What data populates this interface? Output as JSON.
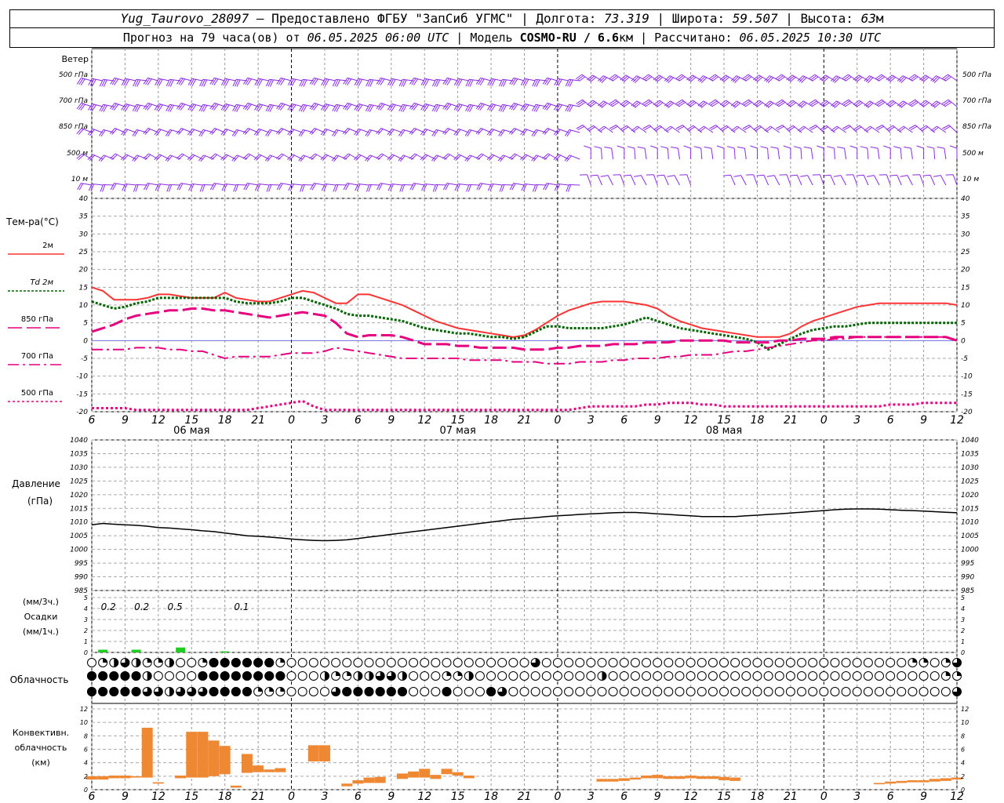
{
  "header": {
    "station": "Yug_Taurovo_28097",
    "provider": " – Предоставлено ФГБУ \"ЗапСиб УГМС\" | Долгота: ",
    "lon": "73.319",
    "lat_label": " | Широта: ",
    "lat": "59.507",
    "alt_label": " | Высота: ",
    "alt": "63",
    "alt_unit": "м",
    "fc_label": "Прогноз на 79 часа(ов) от ",
    "fc_time": "06.05.2025 06:00 UTC",
    "model_label": " | Модель ",
    "model": "COSMO-RU / 6.6",
    "model_unit": "км",
    "calc_label": " | Рассчитано: ",
    "calc_time": "06.05.2025 10:30 UTC"
  },
  "wind_panel": {
    "title": "Ветер",
    "levels": [
      "500 гПа",
      "700 гПа",
      "850 гПа",
      "500 м",
      "10 м"
    ]
  },
  "temp_panel": {
    "title": "Тем-ра(°С)",
    "legend": [
      {
        "label": "2м",
        "color": "#ff3333",
        "style": "solid"
      },
      {
        "label": "Td  2м",
        "color": "#006400",
        "style": "dotted"
      },
      {
        "label": "850 гПа",
        "color": "#e6007e",
        "style": "dash"
      },
      {
        "label": "700 гПа",
        "color": "#e6007e",
        "style": "dashdot"
      },
      {
        "label": "500 гПа",
        "color": "#e6007e",
        "style": "dot"
      }
    ],
    "ticks": [
      "40",
      "35",
      "30",
      "25",
      "20",
      "15",
      "10",
      "5",
      "0",
      "-5",
      "-10",
      "-15",
      "-20"
    ],
    "xticks": [
      "6",
      "9",
      "12",
      "15",
      "18",
      "21",
      "0",
      "3",
      "6",
      "9",
      "12",
      "15",
      "18",
      "21",
      "0",
      "3",
      "6",
      "9",
      "12",
      "15",
      "18",
      "21",
      "0",
      "3",
      "6",
      "9",
      "12"
    ],
    "dates": [
      "06 мая",
      "07 мая",
      "08 мая"
    ]
  },
  "pressure_panel": {
    "title": "Давление",
    "unit": "(гПа)",
    "ticks": [
      "1040",
      "1035",
      "1030",
      "1025",
      "1020",
      "1015",
      "1010",
      "1005",
      "1000",
      "995",
      "990",
      "985"
    ]
  },
  "precip_panel": {
    "label1": "(мм/3ч.)",
    "label2": "Осадки",
    "label3": "(мм/1ч.)",
    "ticks": [
      "5",
      "4",
      "3",
      "2",
      "1",
      "0"
    ],
    "totals": [
      "0.2",
      "0.2",
      "0.5",
      "0.1"
    ]
  },
  "cloud_panel": {
    "title": "Облачность"
  },
  "conv_panel": {
    "label1": "Конвективн.",
    "label2": "облачность",
    "label3": "(км)",
    "ticks": [
      "12",
      "10",
      "8",
      "6",
      "4",
      "2",
      "0"
    ]
  },
  "colors": {
    "wind": "#8a2be2",
    "t2m": "#ff3333",
    "td2m": "#006400",
    "upper": "#e6007e",
    "pressure": "#000000",
    "precip": "#22cc22",
    "conv": "#ee8833"
  },
  "chart_data": [
    {
      "type": "line",
      "name": "temperature",
      "x_hours": [
        0,
        1,
        2,
        3,
        4,
        5,
        6,
        7,
        8,
        9,
        10,
        11,
        12,
        13,
        14,
        15,
        16,
        17,
        18,
        19,
        20,
        21,
        22,
        23,
        24,
        25,
        26,
        27,
        28,
        29,
        30,
        31,
        32,
        33,
        34,
        35,
        36,
        37,
        38,
        39,
        40,
        41,
        42,
        43,
        44,
        45,
        46,
        47,
        48,
        49,
        50,
        51,
        52,
        53,
        54,
        55,
        56,
        57,
        58,
        59,
        60,
        61,
        62,
        63,
        64,
        65,
        66,
        67,
        68,
        69,
        70,
        71,
        72,
        73,
        74,
        75,
        76,
        77,
        78
      ],
      "ylim": [
        -20,
        40
      ],
      "series": [
        {
          "name": "2м",
          "values": [
            15,
            14,
            11.5,
            11.5,
            11.5,
            12,
            13,
            13,
            12.5,
            12,
            12,
            12,
            13.5,
            12,
            11.5,
            11,
            11,
            12,
            13,
            14,
            13.5,
            12,
            10.5,
            10.5,
            13,
            13,
            12,
            11,
            10,
            8.5,
            7,
            5.5,
            4.5,
            3.5,
            3,
            2.5,
            2,
            1.5,
            1,
            1.5,
            3,
            5,
            7,
            8.5,
            9.5,
            10.5,
            11,
            11,
            11,
            10.5,
            10,
            9,
            7,
            5.5,
            4.5,
            3.5,
            3,
            2.5,
            2,
            1.5,
            1,
            1,
            1,
            2,
            4,
            5.5,
            6.5,
            7.5,
            8.5,
            9.5,
            10,
            10.5,
            10.5,
            10.5,
            10.5,
            10.5,
            10.5,
            10.5,
            10
          ]
        },
        {
          "name": "Td  2м",
          "values": [
            11,
            10,
            9,
            9.5,
            10.5,
            11,
            12,
            12,
            12,
            12,
            12,
            12,
            12,
            11,
            10.5,
            10.5,
            10.5,
            11,
            12,
            12,
            11,
            10,
            9,
            7.5,
            7,
            7,
            6.5,
            6,
            5.5,
            4.5,
            3.5,
            3,
            2.5,
            2,
            2,
            1.5,
            1,
            1,
            0.5,
            1,
            2.5,
            4,
            4,
            3.5,
            3.5,
            3.5,
            3.5,
            4,
            4.5,
            5.5,
            6.5,
            5.5,
            4.5,
            3.5,
            3,
            2.5,
            2,
            1.5,
            1,
            0.5,
            -0.5,
            -2.5,
            -1,
            0.5,
            2,
            3,
            3.5,
            4,
            4,
            4.5,
            5,
            5,
            5,
            5,
            5,
            5,
            5,
            5,
            5
          ]
        },
        {
          "name": "850 гПа",
          "values": [
            2.5,
            3.5,
            4.5,
            6,
            7,
            7.5,
            8,
            8.5,
            8.5,
            9,
            9,
            8.5,
            8.5,
            8,
            7.5,
            7,
            6.5,
            7,
            7.5,
            8,
            7.5,
            7,
            5,
            2,
            1,
            1.5,
            1.5,
            1.5,
            1,
            0,
            -1,
            -1,
            -1,
            -1.5,
            -1.5,
            -2,
            -2,
            -2,
            -2,
            -2.5,
            -2.5,
            -2.5,
            -2,
            -2,
            -1.5,
            -1.5,
            -1.5,
            -1,
            -1,
            -1,
            -0.5,
            -0.5,
            -0.5,
            0,
            0,
            0,
            0,
            0,
            -0.5,
            -0.5,
            -0.5,
            -0.5,
            0,
            0,
            0.5,
            0.5,
            0.5,
            1,
            1,
            1,
            1,
            1,
            1,
            1,
            1,
            1,
            1,
            1,
            0
          ]
        },
        {
          "name": "700 гПа",
          "values": [
            -2.5,
            -2.5,
            -2.5,
            -2.5,
            -2,
            -2,
            -2,
            -2.5,
            -2.5,
            -3,
            -3,
            -4,
            -5,
            -4.5,
            -4.5,
            -4.5,
            -4.5,
            -4,
            -3.5,
            -3.5,
            -3.5,
            -3,
            -2,
            -2.5,
            -3,
            -3.5,
            -4,
            -4.5,
            -5,
            -5,
            -5,
            -5,
            -5,
            -5,
            -5.5,
            -5.5,
            -5.5,
            -5.5,
            -6,
            -6,
            -6,
            -6.5,
            -6.5,
            -6.5,
            -6,
            -6,
            -6,
            -5.5,
            -5.5,
            -5,
            -5,
            -5,
            -4.5,
            -4.5,
            -4,
            -4,
            -4,
            -3.5,
            -3,
            -3,
            -2.5,
            -2,
            -1.5,
            -1,
            -0.5,
            0,
            0,
            0.5,
            0.5,
            1,
            1,
            1,
            1,
            1,
            1,
            1,
            1,
            1,
            0
          ]
        },
        {
          "name": "500 гПа",
          "values": [
            -19,
            -19,
            -19,
            -19,
            -19.5,
            -19.5,
            -19.5,
            -19.5,
            -19.5,
            -19.5,
            -19.5,
            -19.5,
            -19.5,
            -19.5,
            -19.5,
            -19,
            -18.5,
            -18,
            -17.5,
            -17,
            -18.5,
            -19.5,
            -19.5,
            -19.5,
            -19.5,
            -19.5,
            -19.5,
            -19.5,
            -19.5,
            -19.5,
            -19.5,
            -19.5,
            -19.5,
            -19.5,
            -19.5,
            -19.5,
            -19.5,
            -19.5,
            -19.5,
            -19.5,
            -19.5,
            -19.5,
            -19.5,
            -19.5,
            -19,
            -18.5,
            -18.5,
            -18.5,
            -18.5,
            -18.5,
            -18,
            -18,
            -17.5,
            -17.5,
            -17.5,
            -18,
            -18,
            -18.5,
            -18.5,
            -18.5,
            -18.5,
            -18.5,
            -18.5,
            -18.5,
            -18.5,
            -18.5,
            -18.5,
            -18.5,
            -18.5,
            -18.5,
            -18.5,
            -18.5,
            -18,
            -18,
            -18,
            -17.5,
            -17.5,
            -17.5,
            -17.5
          ]
        }
      ]
    },
    {
      "type": "line",
      "name": "pressure",
      "ylim": [
        985,
        1040
      ],
      "series": [
        {
          "name": "pressure",
          "values": [
            1009,
            1009.5,
            1009.2,
            1009,
            1008.8,
            1008.5,
            1008,
            1007.8,
            1007.5,
            1007.2,
            1006.8,
            1006.5,
            1006,
            1005.5,
            1005,
            1004.8,
            1004.5,
            1004.2,
            1003.8,
            1003.5,
            1003.3,
            1003.2,
            1003.3,
            1003.5,
            1004,
            1004.5,
            1005,
            1005.5,
            1006,
            1006.5,
            1007,
            1007.5,
            1008,
            1008.5,
            1009,
            1009.5,
            1010,
            1010.5,
            1011,
            1011.3,
            1011.6,
            1012,
            1012.3,
            1012.5,
            1012.8,
            1013,
            1013.2,
            1013.4,
            1013.5,
            1013.5,
            1013.3,
            1013,
            1012.8,
            1012.5,
            1012.3,
            1012,
            1012,
            1012,
            1012,
            1012.3,
            1012.5,
            1012.8,
            1013,
            1013.3,
            1013.6,
            1013.9,
            1014.2,
            1014.5,
            1014.7,
            1014.8,
            1014.8,
            1014.7,
            1014.5,
            1014.3,
            1014.2,
            1014,
            1013.8,
            1013.6,
            1013.4
          ]
        }
      ]
    },
    {
      "type": "bar",
      "name": "precipitation_1h",
      "ylim": [
        0,
        5
      ],
      "bars": [
        [
          1,
          0.25
        ],
        [
          4,
          0.25
        ],
        [
          8,
          0.45
        ],
        [
          12,
          0.1
        ]
      ]
    },
    {
      "type": "bar",
      "name": "convective_cloud",
      "ylim": [
        0,
        12
      ],
      "bars": [
        [
          0,
          1.5,
          2
        ],
        [
          1,
          1.5,
          2
        ],
        [
          2,
          1.7,
          2.1
        ],
        [
          3,
          1.7,
          2.1
        ],
        [
          4,
          1.8,
          2
        ],
        [
          5,
          1.8,
          9.2
        ],
        [
          6,
          0.9,
          1.1
        ],
        [
          8,
          1.7,
          2.1
        ],
        [
          9,
          1.8,
          8.6
        ],
        [
          10,
          1.8,
          8.6
        ],
        [
          11,
          2,
          7.3
        ],
        [
          12,
          2.3,
          6.5
        ],
        [
          13,
          0.3,
          0.6
        ],
        [
          14,
          2.5,
          5.3
        ],
        [
          15,
          2.6,
          3.6
        ],
        [
          16,
          2.6,
          3
        ],
        [
          17,
          2.6,
          3.2
        ],
        [
          20,
          4.2,
          6.6
        ],
        [
          21,
          4.2,
          6.6
        ],
        [
          23,
          0.5,
          0.9
        ],
        [
          24,
          0.9,
          1.4
        ],
        [
          25,
          1,
          1.8
        ],
        [
          26,
          1,
          1.9
        ],
        [
          28,
          1.6,
          2.4
        ],
        [
          29,
          1.8,
          2.7
        ],
        [
          30,
          1.8,
          3.1
        ],
        [
          31,
          1.6,
          2.2
        ],
        [
          32,
          2.3,
          3.1
        ],
        [
          33,
          2.1,
          2.6
        ],
        [
          34,
          1.7,
          2.1
        ],
        [
          46,
          1.2,
          1.6
        ],
        [
          47,
          1.2,
          1.6
        ],
        [
          48,
          1.3,
          1.7
        ],
        [
          49,
          1.5,
          1.8
        ],
        [
          50,
          1.7,
          2.1
        ],
        [
          51,
          1.7,
          2.2
        ],
        [
          52,
          1.6,
          2
        ],
        [
          53,
          1.6,
          2
        ],
        [
          54,
          1.7,
          2.1
        ],
        [
          55,
          1.6,
          2
        ],
        [
          56,
          1.6,
          2
        ],
        [
          57,
          1.4,
          1.9
        ],
        [
          58,
          1.3,
          1.8
        ],
        [
          71,
          0.8,
          1
        ],
        [
          72,
          0.9,
          1.2
        ],
        [
          73,
          1,
          1.3
        ],
        [
          74,
          1.1,
          1.4
        ],
        [
          75,
          1.1,
          1.4
        ],
        [
          76,
          1.2,
          1.6
        ],
        [
          77,
          1.3,
          1.7
        ],
        [
          78,
          1.5,
          1.8
        ]
      ]
    },
    {
      "type": "table",
      "name": "cloudiness",
      "rows": [
        "0644000464000444404440000000000000000000000000000000000000000000000000000000000000000000000000000000000000000000000000000000000000000000000000000000000000000000000000000000000000000000000000000000000000000000000000000000000000000000000000000000000000000000000000000000000000000000000000000000000000000000000000000000000000000000000000000000000000000000000000000000000000000000000",
        "44440000004444440000020000000000000000000000000000000000000000000000000000000000000000"
      ]
    }
  ]
}
